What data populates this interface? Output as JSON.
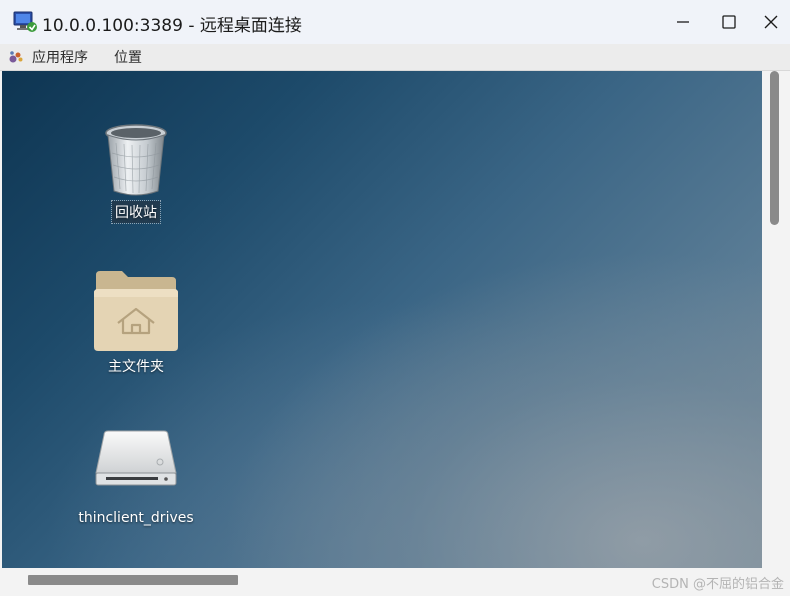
{
  "window": {
    "title": "10.0.0.100:3389 - 远程桌面连接",
    "icon": "remote-desktop-icon",
    "controls": [
      "minimize-icon",
      "maximize-icon",
      "close-icon"
    ]
  },
  "menubar": {
    "applications": "应用程序",
    "places": "位置"
  },
  "desktop": {
    "icons": [
      {
        "label": "回收站",
        "icon": "trash-icon",
        "selected": true
      },
      {
        "label": "主文件夹",
        "icon": "home-folder-icon",
        "selected": false
      },
      {
        "label": "thinclient_drives",
        "icon": "drive-icon",
        "selected": false
      }
    ]
  },
  "watermark": "CSDN @不屈的铝合金"
}
